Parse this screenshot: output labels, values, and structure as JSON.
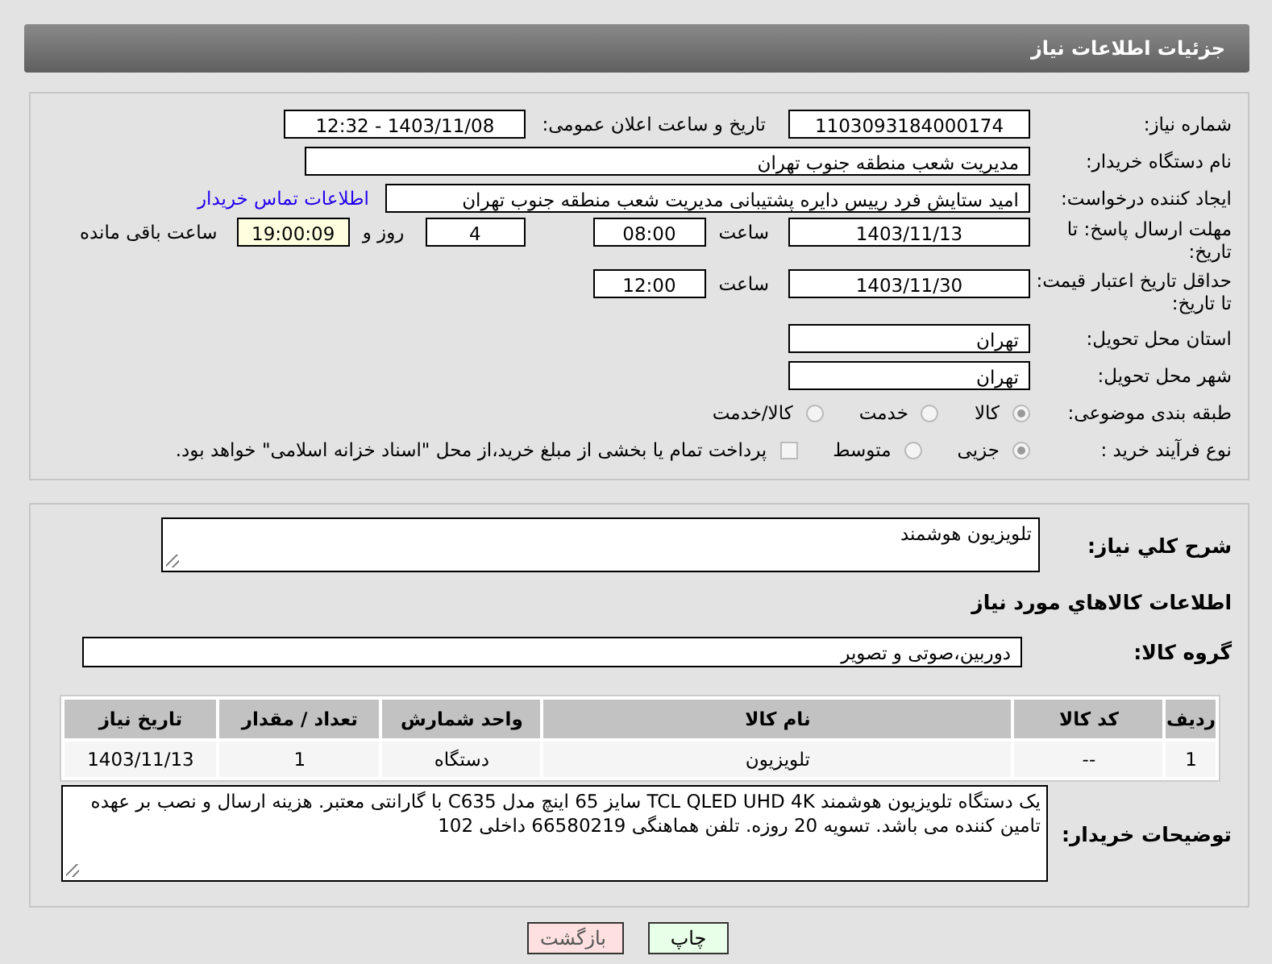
{
  "header": {
    "title": "جزئیات اطلاعات نیاز"
  },
  "details": {
    "need_number": {
      "label": "شماره نیاز:",
      "value": "1103093184000174"
    },
    "announce": {
      "label": "تاریخ و ساعت اعلان عمومی:",
      "value": "1403/11/08 - 12:32"
    },
    "buyer": {
      "label": "نام دستگاه خریدار:",
      "value": "مدیریت شعب منطقه جنوب تهران"
    },
    "creator": {
      "label": "ایجاد کننده درخواست:",
      "value": "امید ستایش فرد رییس دایره پشتیبانی مدیریت شعب منطقه جنوب تهران",
      "link": "اطلاعات تماس خریدار"
    },
    "deadline": {
      "label": "مهلت ارسال پاسخ: تا تاریخ:",
      "date": "1403/11/13",
      "time_label": "ساعت",
      "time": "08:00",
      "days": "4",
      "days_label": "روز و",
      "remaining": "19:00:09",
      "remaining_label": "ساعت باقی مانده"
    },
    "validity": {
      "label": "حداقل تاریخ اعتبار قیمت: تا تاریخ:",
      "date": "1403/11/30",
      "time_label": "ساعت",
      "time": "12:00"
    },
    "province": {
      "label": "استان محل تحویل:",
      "value": "تهران"
    },
    "city": {
      "label": "شهر محل تحویل:",
      "value": "تهران"
    },
    "category": {
      "label": "طبقه بندی موضوعی:",
      "options": [
        {
          "label": "کالا",
          "selected": true
        },
        {
          "label": "خدمت",
          "selected": false
        },
        {
          "label": "کالا/خدمت",
          "selected": false
        }
      ]
    },
    "process": {
      "label": "نوع فرآیند خرید :",
      "options": [
        {
          "label": "جزیی",
          "selected": true
        },
        {
          "label": "متوسط",
          "selected": false
        }
      ],
      "treasury": {
        "label": "پرداخت تمام یا بخشی از مبلغ خرید،از محل \"اسناد خزانه اسلامی\" خواهد بود.",
        "checked": false
      }
    }
  },
  "goods": {
    "summary": {
      "label": "شرح کلي نياز:",
      "value": "تلویزیون هوشمند"
    },
    "heading": "اطلاعات کالاهاي مورد نياز",
    "group": {
      "label": "گروه کالا:",
      "value": "دوربین،صوتی و تصویر"
    },
    "table": {
      "columns": [
        "ردیف",
        "کد کالا",
        "نام کالا",
        "واحد شمارش",
        "تعداد / مقدار",
        "تاریخ نیاز"
      ],
      "rows": [
        [
          "1",
          "--",
          "تلویزیون",
          "دستگاه",
          "1",
          "1403/11/13"
        ]
      ]
    },
    "notes": {
      "label": "توضیحات خریدار:",
      "value": "یک دستگاه تلویزیون هوشمند TCL QLED UHD 4K سایز 65 اینچ مدل C635 با گارانتی معتبر. هزینه ارسال و نصب بر عهده تامین کننده می باشد. تسویه 20 روزه. تلفن هماهنگی 66580219 داخلی 102"
    }
  },
  "buttons": [
    {
      "label": "چاپ",
      "kind": "print"
    },
    {
      "label": "بازگشت",
      "kind": "back"
    }
  ]
}
